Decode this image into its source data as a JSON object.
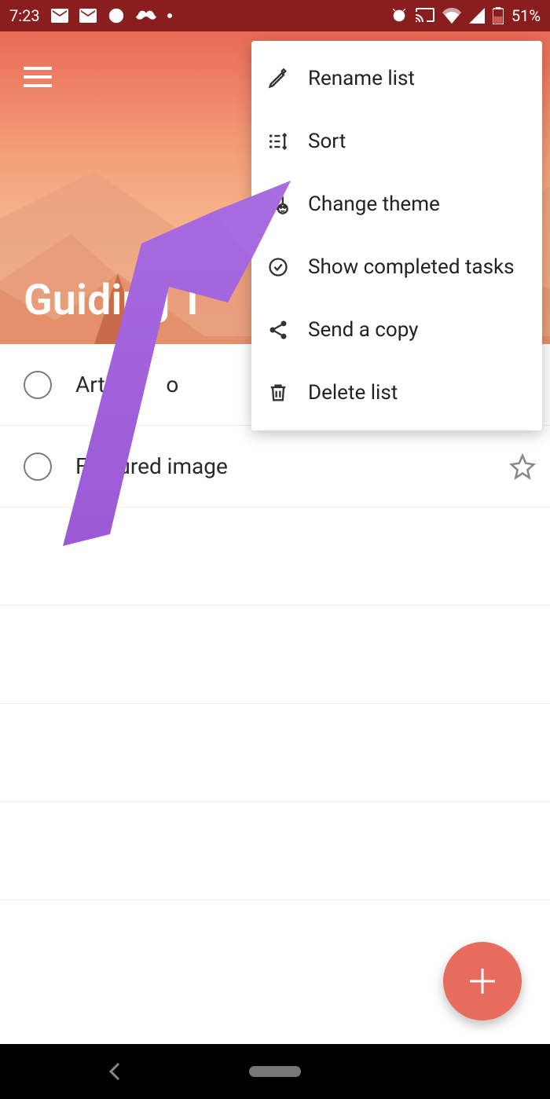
{
  "status": {
    "time": "7:23",
    "battery": "51%"
  },
  "list": {
    "title": "Guiding T"
  },
  "tasks": [
    {
      "label": "Article",
      "partial_obscured_suffix": "o",
      "star": false
    },
    {
      "label": "Featured image",
      "star": true
    }
  ],
  "menu": {
    "items": [
      {
        "label": "Rename list"
      },
      {
        "label": "Sort"
      },
      {
        "label": "Change theme"
      },
      {
        "label": "Show completed tasks"
      },
      {
        "label": "Send a copy"
      },
      {
        "label": "Delete list"
      }
    ]
  }
}
